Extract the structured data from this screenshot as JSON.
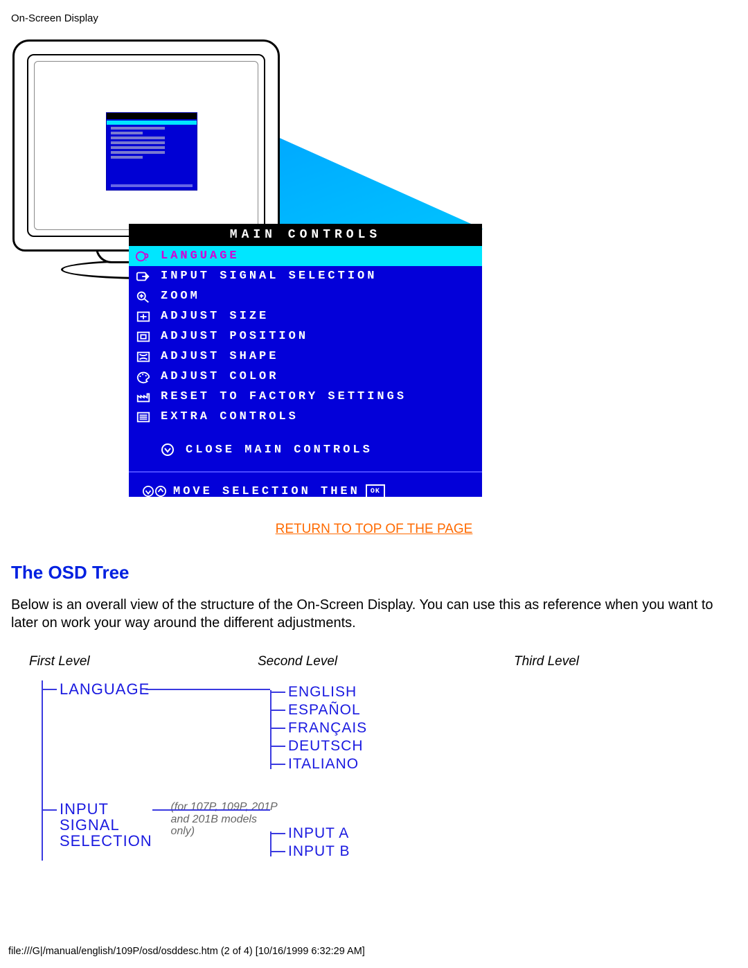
{
  "header": {
    "title": "On-Screen Display"
  },
  "osd": {
    "title": "MAIN CONTROLS",
    "items": [
      {
        "label": "LANGUAGE",
        "icon": "globe-question-icon",
        "selected": true
      },
      {
        "label": "INPUT SIGNAL SELECTION",
        "icon": "input-arrow-icon",
        "selected": false
      },
      {
        "label": "ZOOM",
        "icon": "magnifier-icon",
        "selected": false
      },
      {
        "label": "ADJUST SIZE",
        "icon": "resize-icon",
        "selected": false
      },
      {
        "label": "ADJUST POSITION",
        "icon": "position-icon",
        "selected": false
      },
      {
        "label": "ADJUST SHAPE",
        "icon": "shape-icon",
        "selected": false
      },
      {
        "label": "ADJUST COLOR",
        "icon": "palette-icon",
        "selected": false
      },
      {
        "label": "RESET TO FACTORY SETTINGS",
        "icon": "factory-icon",
        "selected": false
      },
      {
        "label": "EXTRA CONTROLS",
        "icon": "list-icon",
        "selected": false
      }
    ],
    "close": "CLOSE MAIN CONTROLS",
    "footer": "MOVE SELECTION THEN",
    "footer_ok": "OK"
  },
  "return_link": "RETURN TO TOP OF THE PAGE",
  "section": {
    "heading": "The OSD Tree",
    "paragraph": "Below is an overall view of the structure of the On-Screen Display. You can use this as reference when you want to later on work your way around the different adjustments."
  },
  "tree": {
    "level_labels": {
      "l1": "First Level",
      "l2": "Second Level",
      "l3": "Third Level"
    },
    "nodes": [
      {
        "label": "LANGUAGE",
        "note": "",
        "children": [
          "ENGLISH",
          "ESPAÑOL",
          "FRANÇAIS",
          "DEUTSCH",
          "ITALIANO"
        ]
      },
      {
        "label": "INPUT SIGNAL SELECTION",
        "note": "(for 107P, 109P, 201P and 201B models only)",
        "children": [
          "INPUT A",
          "INPUT B"
        ]
      }
    ]
  },
  "footer": "file:///G|/manual/english/109P/osd/osddesc.htm (2 of 4) [10/16/1999 6:32:29 AM]"
}
